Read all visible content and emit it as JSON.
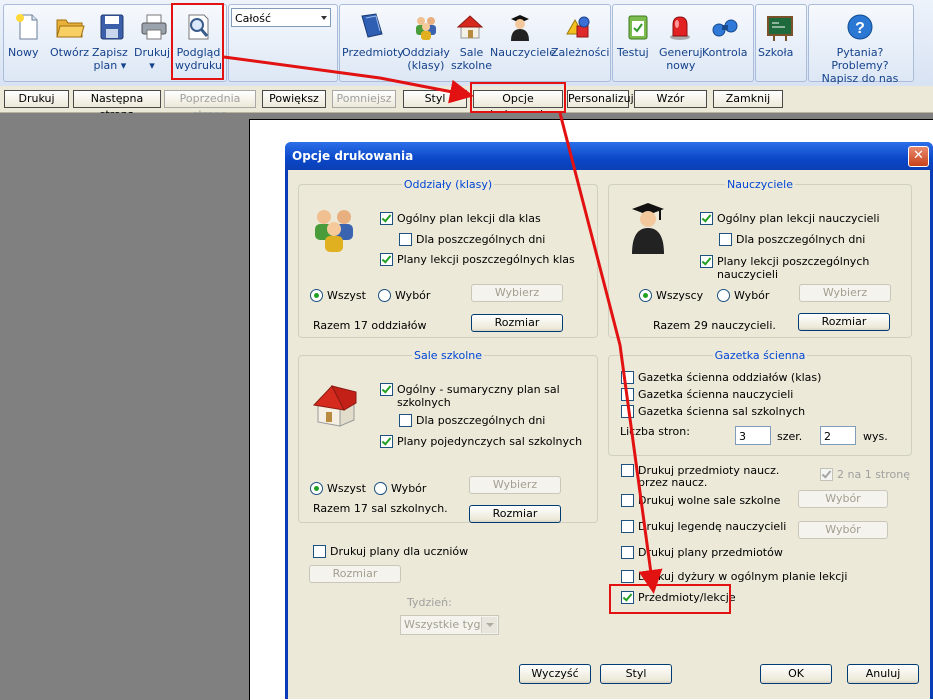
{
  "ribbon": {
    "buttons": [
      {
        "label": "Nowy",
        "icon": "new-icon"
      },
      {
        "label": "Otwórz",
        "icon": "open-folder-icon"
      },
      {
        "label": "Zapisz\nplan ▾",
        "icon": "save-icon"
      },
      {
        "label": "Drukuj\n▾",
        "icon": "printer-icon"
      },
      {
        "label": "Podgląd\nwydruku",
        "icon": "print-preview-icon"
      },
      {
        "label": "Przedmioty",
        "icon": "book-icon"
      },
      {
        "label": "Oddziały\n(klasy)",
        "icon": "students-group-icon"
      },
      {
        "label": "Sale\nszkolne",
        "icon": "house-icon"
      },
      {
        "label": "Nauczyciele",
        "icon": "teacher-icon"
      },
      {
        "label": "Zależności",
        "icon": "shapes-icon"
      },
      {
        "label": "Testuj",
        "icon": "clipboard-test-icon"
      },
      {
        "label": "Generuj\nnowy",
        "icon": "red-light-icon"
      },
      {
        "label": "Kontrola",
        "icon": "binoculars-icon"
      },
      {
        "label": "Szkoła",
        "icon": "chalkboard-icon"
      },
      {
        "label": "Pytania? Problemy?\nNapisz do nas",
        "icon": "help-icon"
      }
    ],
    "scope_select": "Całość"
  },
  "toolbar": {
    "print": "Drukuj",
    "next_page": "Następna strona",
    "prev_page": "Poprzednia strona",
    "zoom_in": "Powiększ",
    "zoom_out": "Pomniejsz",
    "style": "Styl",
    "print_options": "Opcje drukowania",
    "personalize": "Personalizuj",
    "template": "Wzór",
    "close": "Zamknij"
  },
  "dialog": {
    "title": "Opcje drukowania",
    "close_glyph": "✕",
    "classes": {
      "legend": "Oddziały (klasy)",
      "general": "Ogólny plan lekcji dla klas",
      "per_day": "Dla poszczególnych dni",
      "each_plan": "Plany lekcji poszczególnych klas",
      "radio_all": "Wszyst",
      "radio_select": "Wybór",
      "select_btn": "Wybierz",
      "total": "Razem 17 oddziałów",
      "size_btn": "Rozmiar"
    },
    "teachers": {
      "legend": "Nauczyciele",
      "general": "Ogólny plan lekcji nauczycieli",
      "per_day": "Dla poszczególnych dni",
      "each_plan_1": "Plany lekcji poszczególnych",
      "each_plan_2": "nauczycieli",
      "radio_all": "Wszyscy",
      "radio_select": "Wybór",
      "select_btn": "Wybierz",
      "total": "Razem 29 nauczycieli.",
      "size_btn": "Rozmiar"
    },
    "rooms": {
      "legend": "Sale szkolne",
      "general_1": "Ogólny - sumaryczny plan sal",
      "general_2": "szkolnych",
      "per_day": "Dla poszczególnych dni",
      "each_plan": "Plany pojedynczych sal szkolnych",
      "radio_all": "Wszyst",
      "radio_select": "Wybór",
      "select_btn": "Wybierz",
      "total": "Razem 17 sal szkolnych.",
      "size_btn": "Rozmiar"
    },
    "wall": {
      "legend": "Gazetka ścienna",
      "classes": "Gazetka ścienna oddziałów (klas)",
      "teachers": "Gazetka ścienna nauczycieli",
      "rooms": "Gazetka ścienna sal szkolnych",
      "pages_label": "Liczba stron:",
      "cols": "3",
      "cols_label": "szer.",
      "rows": "2",
      "rows_label": "wys."
    },
    "extra": {
      "subjects_teacher_1": "Drukuj przedmioty naucz.",
      "subjects_teacher_2": "przez naucz.",
      "two_on_one": "2 na 1 stronę",
      "free_rooms": "Drukuj wolne sale szkolne",
      "legend_teachers": "Drukuj legendę nauczycieli",
      "subject_plans": "Drukuj plany przedmiotów",
      "duties": "Drukuj dyżury w ogólnym planie lekcji",
      "subjects_lessons": "Przedmioty/lekcje",
      "select_btn": "Wybór"
    },
    "students": {
      "label": "Drukuj plany dla uczniów",
      "size_btn": "Rozmiar",
      "week_label": "Tydzień:",
      "week_value": "Wszystkie tygod"
    },
    "buttons": {
      "clear": "Wyczyść",
      "style": "Styl",
      "ok": "OK",
      "cancel": "Anuluj"
    }
  },
  "colors": {
    "ribbon_text": "#15428b",
    "dialog_title": "#0a47c9",
    "legend": "#0046d5",
    "highlight": "#e21212",
    "check": "#21a121"
  }
}
